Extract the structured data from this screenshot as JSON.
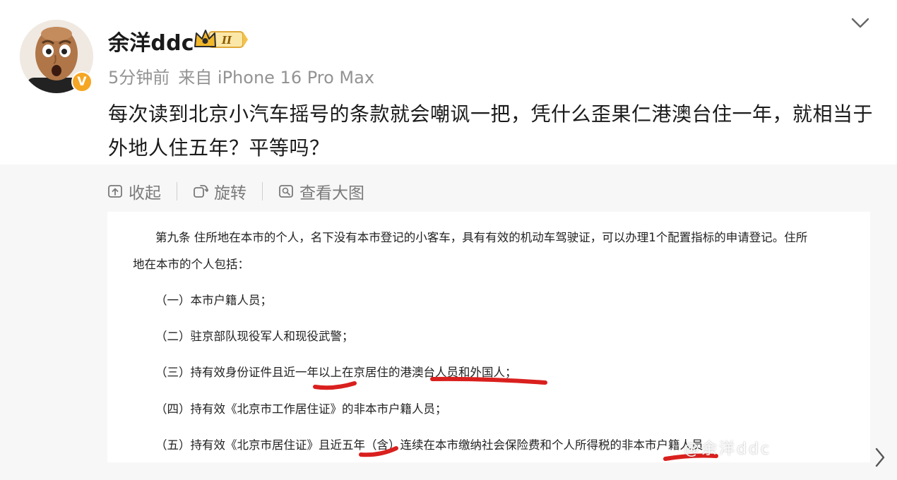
{
  "post": {
    "username": "余洋ddc",
    "badge_level": "II",
    "time": "5分钟前",
    "source": "来自 iPhone 16 Pro Max",
    "text": "每次读到北京小汽车摇号的条款就会嘲讽一把，凭什么歪果仁港澳台住一年，就相当于外地人住五年？平等吗？"
  },
  "media_toolbar": {
    "collapse_label": "收起",
    "rotate_label": "旋转",
    "view_large_label": "查看大图"
  },
  "document_image": {
    "line1": "第九条 住所地在本市的个人，名下没有本市登记的小客车，具有有效的机动车驾驶证，可以办理1个配置指标的申请登记。住所",
    "line2": "地在本市的个人包括：",
    "item1": "（一）本市户籍人员；",
    "item2": "（二）驻京部队现役军人和现役武警；",
    "item3": "（三）持有效身份证件且近一年以上在京居住的港澳台人员和外国人；",
    "item4": "（四）持有效《北京市工作居住证》的非本市户籍人员；",
    "item5": "（五）持有效《北京市居住证》且近五年（含）连续在本市缴纳社会保险费和个人所得税的非本市户籍人员"
  },
  "watermark": "@余洋ddc",
  "colors": {
    "verify_badge": "#f5a623",
    "text_primary": "#1a1a1a",
    "text_meta": "#939393",
    "toolbar_text": "#7a7a7a",
    "panel_bg": "#f7f7f7",
    "annotation_red": "#d9201e"
  },
  "icons": {
    "verify": "verified-v-icon",
    "badge": "crown-level-badge-icon",
    "menu": "chevron-down-icon",
    "collapse": "collapse-icon",
    "rotate": "rotate-icon",
    "view_large": "view-large-icon",
    "next": "chevron-right-icon"
  }
}
